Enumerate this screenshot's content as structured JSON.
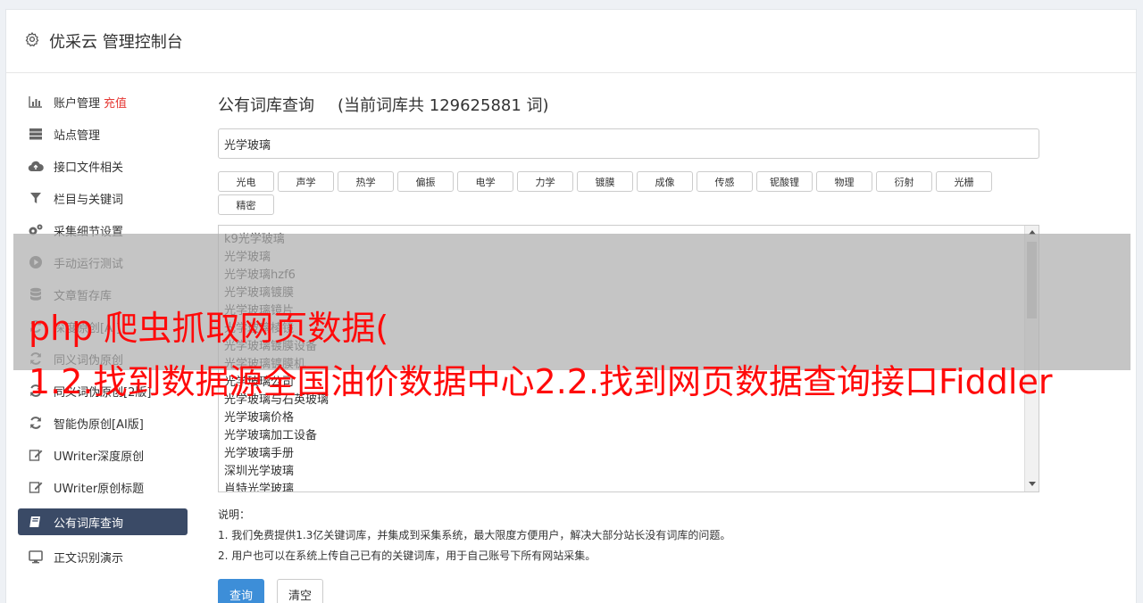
{
  "header": {
    "title": "优采云 管理控制台"
  },
  "sidebar": {
    "items": [
      {
        "label": "账户管理",
        "extra": "充值",
        "icon": "bar-chart-icon"
      },
      {
        "label": "站点管理",
        "icon": "server-icon"
      },
      {
        "label": "接口文件相关",
        "icon": "cloud-upload-icon"
      },
      {
        "label": "栏目与关键词",
        "icon": "filter-icon"
      },
      {
        "label": "采集细节设置",
        "icon": "gears-icon"
      },
      {
        "label": "手动运行测试",
        "icon": "play-icon"
      },
      {
        "label": "文章暂存库",
        "icon": "database-icon"
      },
      {
        "label": "深度原创[AI]",
        "icon": "refresh-icon"
      },
      {
        "label": "同义词伪原创",
        "icon": "refresh-icon"
      },
      {
        "label": "同义词伪原创[2版]",
        "icon": "refresh-icon"
      },
      {
        "label": "智能伪原创[AI版]",
        "icon": "refresh-icon"
      },
      {
        "label": "UWriter深度原创",
        "icon": "edit-icon"
      },
      {
        "label": "UWriter原创标题",
        "icon": "edit-icon"
      },
      {
        "label": "公有词库查询",
        "icon": "book-icon",
        "active": true
      },
      {
        "label": "正文识别演示",
        "icon": "monitor-icon"
      }
    ]
  },
  "main": {
    "title": "公有词库查询",
    "count_text": "(当前词库共 129625881 词)",
    "query_value": "光学玻璃",
    "tags": [
      "光电",
      "声学",
      "热学",
      "偏振",
      "电学",
      "力学",
      "镀膜",
      "成像",
      "传感",
      "铌酸锂",
      "物理",
      "衍射",
      "光栅",
      "精密"
    ],
    "results": [
      "k9光学玻璃",
      "光学玻璃",
      "光学玻璃hzf6",
      "光学玻璃镀膜",
      "光学玻璃镜片",
      "光学玻璃棱镜",
      "光学玻璃镀膜设备",
      "光学玻璃镀膜机",
      "光学玻璃公司",
      "光学玻璃与石英玻璃",
      "光学玻璃价格",
      "光学玻璃加工设备",
      "光学玻璃手册",
      "深圳光学玻璃",
      "肖特光学玻璃"
    ],
    "notes_title": "说明：",
    "notes": [
      "1. 我们免费提供1.3亿关键词库，并集成到采集系统，最大限度方便用户，解决大部分站长没有词库的问题。",
      "2. 用户也可以在系统上传自己已有的关键词库，用于自己账号下所有网站采集。"
    ],
    "search_btn": "查询",
    "clear_btn": "清空"
  },
  "overlay": {
    "line1": "php 爬虫抓取网页数据(",
    "line2": "1.2.找到数据源全国油价数据中心2.2.找到网页数据查询接口Fiddler"
  },
  "colors": {
    "accent": "#3d8ed8",
    "sidebar_active": "#3a4a66",
    "overlay_text": "#ff0a0a",
    "recharge": "#e53935"
  }
}
